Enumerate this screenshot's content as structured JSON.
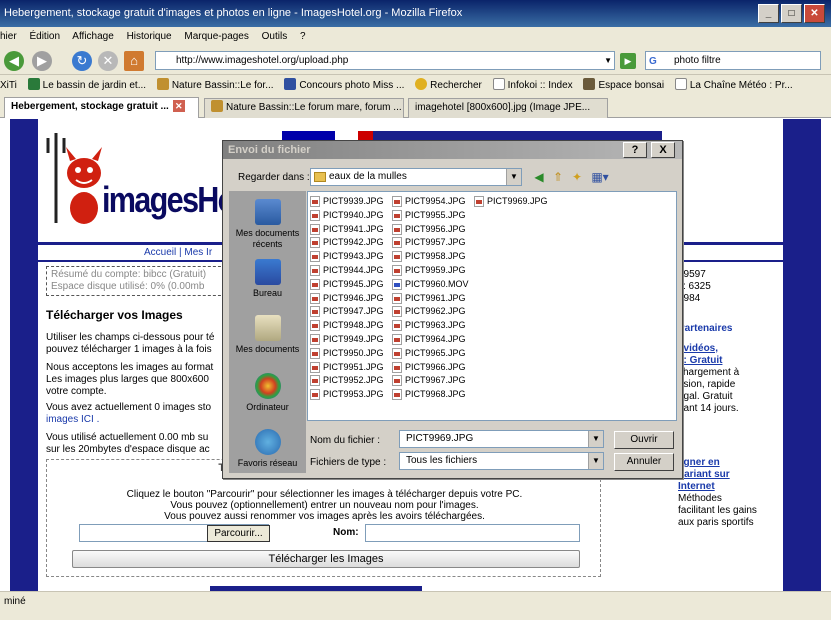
{
  "window": {
    "title": "Hebergement, stockage gratuit d'images et photos en ligne - ImagesHotel.org - Mozilla Firefox"
  },
  "menu": [
    "hier",
    "Édition",
    "Affichage",
    "Historique",
    "Marque-pages",
    "Outils",
    "?"
  ],
  "toolbar": {
    "url": "http://www.imageshotel.org/upload.php",
    "search_value": "photo filtre"
  },
  "bookmarks": [
    "XiTi",
    "Le bassin de jardin et...",
    "Nature Bassin::Le for...",
    "Concours photo Miss ...",
    "Rechercher",
    "Infokoi :: Index",
    "Espace bonsai",
    "La Chaîne Météo : Pr..."
  ],
  "tabs": [
    {
      "label": "Hebergement, stockage gratuit ..."
    },
    {
      "label": "Nature Bassin::Le forum mare, forum ..."
    },
    {
      "label": "imagehotel [800x600].jpg (Image JPE..."
    }
  ],
  "page": {
    "logo_text": "imagesHot",
    "nav_links": "Accueil  |  Mes Ir",
    "account_line1": "Résumé du compte: bibcc (Gratuit)",
    "account_line2": "Espace disque utilisé: 0% (0.00mb",
    "heading": "Télécharger vos Images",
    "para1_line1": "Utiliser les champs ci-dessous pour té",
    "para1_line2": "pouvez télécharger 1 images à la fois",
    "para2_line1": "Nous acceptons les images au format",
    "para2_line2": "Les images plus larges que 800x600",
    "para2_line3": "votre compte.",
    "para3_line1": "Vous avez actuellement 0 images sto",
    "para3_line2": "images ICI .",
    "para4_line1": "Vous utilisé actuellement 0.00 mb su",
    "para4_line2": "sur les 20mbytes d'espace disque ac",
    "right_stats": [
      "79597",
      "s: 6325",
      ": 984"
    ],
    "right_partners": "Partenaires",
    "right_ad_title1": ", vidéos,",
    "right_ad_title2": "x: Gratuit",
    "right_ad_text": [
      "chargement à",
      "usion, rapide",
      "égal. Gratuit",
      "dant 14 jours."
    ],
    "right_ad2_title": [
      "agner en",
      "pariant sur",
      "Internet"
    ],
    "right_ad2_text": [
      "Méthodes",
      "facilitant les gains",
      "aux paris sportifs"
    ],
    "upload_heading": "Télécharger des images depuis votre PC",
    "upload_line1": "Cliquez le bouton \"Parcourir\" pour sélectionner les images à télécharger depuis votre PC.",
    "upload_line2": "Vous pouvez (optionnellement) entrer un nouveau nom pour l'images.",
    "upload_line3": "Vous pouvez aussi renommer vos images après les avoirs téléchargées.",
    "browse_label": "Parcourir...",
    "name_label": "Nom:",
    "upload_button": "Télécharger les Images"
  },
  "status": "miné",
  "dialog": {
    "title": "Envoi du fichier",
    "help_label": "?",
    "close_label": "X",
    "look_in_label": "Regarder dans :",
    "look_in_value": "eaux de la mulles",
    "places": [
      "Mes documents récents",
      "Bureau",
      "Mes documents",
      "Ordinateur",
      "Favoris réseau"
    ],
    "files_col1": [
      "PICT9939.JPG",
      "PICT9940.JPG",
      "PICT9941.JPG",
      "PICT9942.JPG",
      "PICT9943.JPG",
      "PICT9944.JPG",
      "PICT9945.JPG",
      "PICT9946.JPG",
      "PICT9947.JPG",
      "PICT9948.JPG",
      "PICT9949.JPG",
      "PICT9950.JPG",
      "PICT9951.JPG",
      "PICT9952.JPG",
      "PICT9953.JPG"
    ],
    "files_col2": [
      "PICT9954.JPG",
      "PICT9955.JPG",
      "PICT9956.JPG",
      "PICT9957.JPG",
      "PICT9958.JPG",
      "PICT9959.JPG",
      "PICT9960.MOV",
      "PICT9961.JPG",
      "PICT9962.JPG",
      "PICT9963.JPG",
      "PICT9964.JPG",
      "PICT9965.JPG",
      "PICT9966.JPG",
      "PICT9967.JPG",
      "PICT9968.JPG"
    ],
    "files_col3": [
      "PICT9969.JPG"
    ],
    "filename_label": "Nom du fichier :",
    "filename_value": "PICT9969.JPG",
    "filetype_label": "Fichiers de type :",
    "filetype_value": "Tous les fichiers",
    "open_button": "Ouvrir",
    "cancel_button": "Annuler"
  }
}
